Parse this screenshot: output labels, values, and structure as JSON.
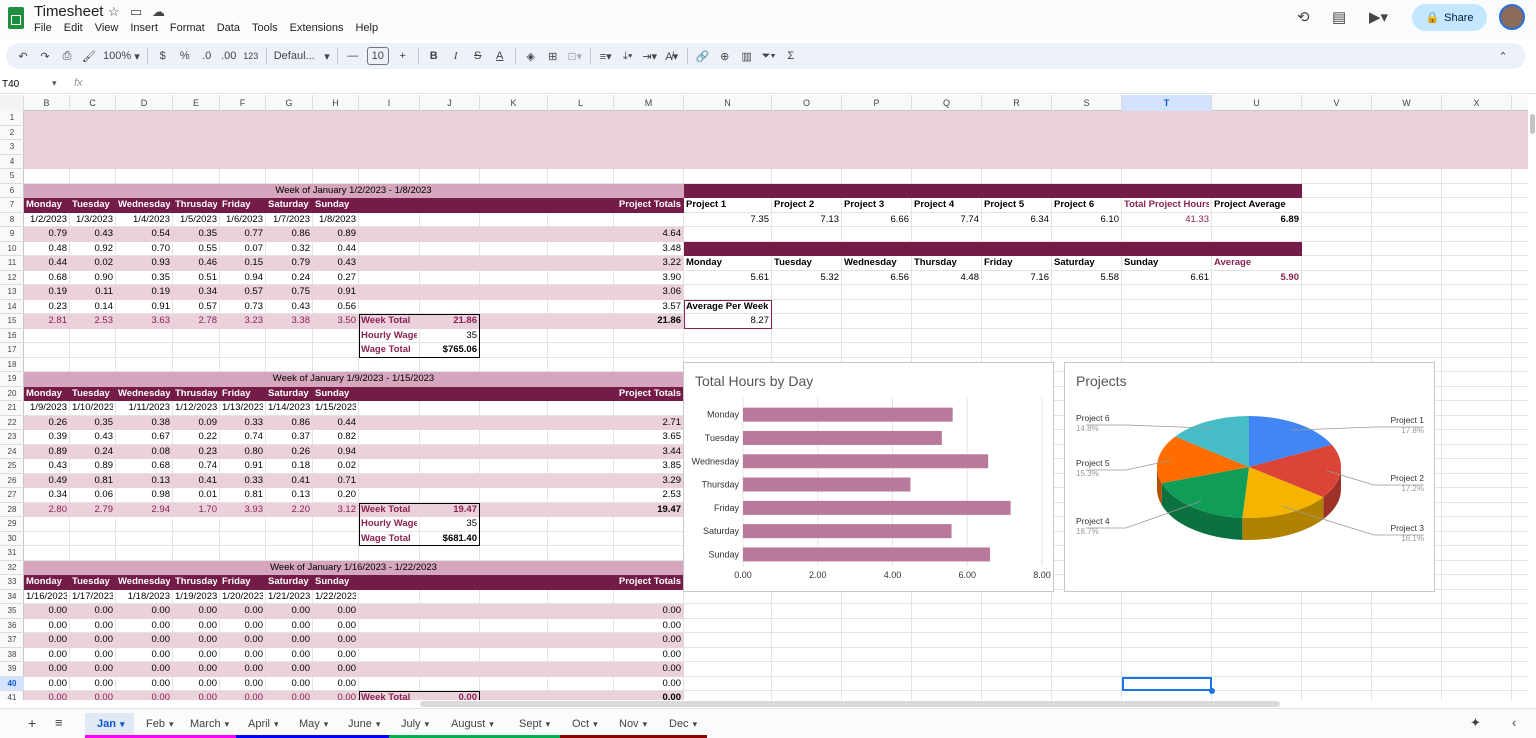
{
  "app": {
    "title": "Timesheet",
    "menus": [
      "File",
      "Edit",
      "View",
      "Insert",
      "Format",
      "Data",
      "Tools",
      "Extensions",
      "Help"
    ],
    "share_label": "Share"
  },
  "toolbar": {
    "zoom": "100%",
    "currency": "$",
    "percent": "%",
    "dec_less": ".0",
    "dec_more": ".00",
    "num_format": "123",
    "font": "Defaul...",
    "font_size": "10",
    "sum": "Σ"
  },
  "formula": {
    "cell_ref": "T40",
    "fx": "fx",
    "value": ""
  },
  "columns": [
    "B",
    "C",
    "D",
    "E",
    "F",
    "G",
    "H",
    "I",
    "J",
    "K",
    "L",
    "M",
    "N",
    "O",
    "P",
    "Q",
    "R",
    "S",
    "T",
    "U",
    "V",
    "W",
    "X"
  ],
  "selected_column": "T",
  "selected_row": "40",
  "rows": [
    "1",
    "2",
    "3",
    "4",
    "5",
    "6",
    "7",
    "8",
    "9",
    "10",
    "11",
    "12",
    "13",
    "14",
    "15",
    "16",
    "17",
    "18",
    "19",
    "20",
    "21",
    "22",
    "23",
    "24",
    "25",
    "26",
    "27",
    "28",
    "29",
    "30",
    "31",
    "32",
    "33",
    "34",
    "35",
    "36",
    "37",
    "38",
    "39",
    "40",
    "41"
  ],
  "day_headers": [
    "Monday",
    "Tuesday",
    "Wednesday",
    "Thrusday",
    "Friday",
    "Saturday",
    "Sunday"
  ],
  "project_totals_label": "Project Totals",
  "week_total_label": "Week Total",
  "hourly_wage_label": "Hourly Wage",
  "wage_total_label": "Wage Total",
  "weeks": [
    {
      "title": "Week of January 1/2/2023 - 1/8/2023",
      "dates": [
        "1/2/2023",
        "1/3/2023",
        "1/4/2023",
        "1/5/2023",
        "1/6/2023",
        "1/7/2023",
        "1/8/2023"
      ],
      "rows": [
        {
          "v": [
            "0.79",
            "0.43",
            "0.54",
            "0.35",
            "0.77",
            "0.86",
            "0.89"
          ],
          "total": "4.64"
        },
        {
          "v": [
            "0.48",
            "0.92",
            "0.70",
            "0.55",
            "0.07",
            "0.32",
            "0.44"
          ],
          "total": "3.48"
        },
        {
          "v": [
            "0.44",
            "0.02",
            "0.93",
            "0.46",
            "0.15",
            "0.79",
            "0.43"
          ],
          "total": "3.22"
        },
        {
          "v": [
            "0.68",
            "0.90",
            "0.35",
            "0.51",
            "0.94",
            "0.24",
            "0.27"
          ],
          "total": "3.90"
        },
        {
          "v": [
            "0.19",
            "0.11",
            "0.19",
            "0.34",
            "0.57",
            "0.75",
            "0.91"
          ],
          "total": "3.06"
        },
        {
          "v": [
            "0.23",
            "0.14",
            "0.91",
            "0.57",
            "0.73",
            "0.43",
            "0.56"
          ],
          "total": "3.57"
        }
      ],
      "day_totals": [
        "2.81",
        "2.53",
        "3.63",
        "2.78",
        "3.23",
        "3.38",
        "3.50"
      ],
      "week_total": "21.86",
      "grand_total": "21.86",
      "hourly_wage": "35",
      "wage_total": "$765.06"
    },
    {
      "title": "Week of January 1/9/2023 - 1/15/2023",
      "dates": [
        "1/9/2023",
        "1/10/2023",
        "1/11/2023",
        "1/12/2023",
        "1/13/2023",
        "1/14/2023",
        "1/15/2023"
      ],
      "rows": [
        {
          "v": [
            "0.26",
            "0.35",
            "0.38",
            "0.09",
            "0.33",
            "0.86",
            "0.44"
          ],
          "total": "2.71"
        },
        {
          "v": [
            "0.39",
            "0.43",
            "0.67",
            "0.22",
            "0.74",
            "0.37",
            "0.82"
          ],
          "total": "3.65"
        },
        {
          "v": [
            "0.89",
            "0.24",
            "0.08",
            "0.23",
            "0.80",
            "0.26",
            "0.94"
          ],
          "total": "3.44"
        },
        {
          "v": [
            "0.43",
            "0.89",
            "0.68",
            "0.74",
            "0.91",
            "0.18",
            "0.02"
          ],
          "total": "3.85"
        },
        {
          "v": [
            "0.49",
            "0.81",
            "0.13",
            "0.41",
            "0.33",
            "0.41",
            "0.71"
          ],
          "total": "3.29"
        },
        {
          "v": [
            "0.34",
            "0.06",
            "0.98",
            "0.01",
            "0.81",
            "0.13",
            "0.20"
          ],
          "total": "2.53"
        }
      ],
      "day_totals": [
        "2.80",
        "2.79",
        "2.94",
        "1.70",
        "3.93",
        "2.20",
        "3.12"
      ],
      "week_total": "19.47",
      "grand_total": "19.47",
      "hourly_wage": "35",
      "wage_total": "$681.40"
    },
    {
      "title": "Week of January 1/16/2023 - 1/22/2023",
      "dates": [
        "1/16/2023",
        "1/17/2023",
        "1/18/2023",
        "1/19/2023",
        "1/20/2023",
        "1/21/2023",
        "1/22/2023"
      ],
      "rows": [
        {
          "v": [
            "0.00",
            "0.00",
            "0.00",
            "0.00",
            "0.00",
            "0.00",
            "0.00"
          ],
          "total": "0.00"
        },
        {
          "v": [
            "0.00",
            "0.00",
            "0.00",
            "0.00",
            "0.00",
            "0.00",
            "0.00"
          ],
          "total": "0.00"
        },
        {
          "v": [
            "0.00",
            "0.00",
            "0.00",
            "0.00",
            "0.00",
            "0.00",
            "0.00"
          ],
          "total": "0.00"
        },
        {
          "v": [
            "0.00",
            "0.00",
            "0.00",
            "0.00",
            "0.00",
            "0.00",
            "0.00"
          ],
          "total": "0.00"
        },
        {
          "v": [
            "0.00",
            "0.00",
            "0.00",
            "0.00",
            "0.00",
            "0.00",
            "0.00"
          ],
          "total": "0.00"
        },
        {
          "v": [
            "0.00",
            "0.00",
            "0.00",
            "0.00",
            "0.00",
            "0.00",
            "0.00"
          ],
          "total": "0.00"
        }
      ],
      "day_totals": [
        "0.00",
        "0.00",
        "0.00",
        "0.00",
        "0.00",
        "0.00",
        "0.00"
      ],
      "week_total": "0.00",
      "grand_total": "0.00"
    }
  ],
  "summary": {
    "project_headers": [
      "Project 1",
      "Project 2",
      "Project 3",
      "Project 4",
      "Project 5",
      "Project 6",
      "Total Project Hours",
      "Project Average"
    ],
    "project_values": [
      "7.35",
      "7.13",
      "6.66",
      "7.74",
      "6.34",
      "6.10",
      "41.33",
      "6.89"
    ],
    "day_headers": [
      "Monday",
      "Tuesday",
      "Wednesday",
      "Thursday",
      "Friday",
      "Saturday",
      "Sunday",
      "Average"
    ],
    "day_values": [
      "5.61",
      "5.32",
      "6.56",
      "4.48",
      "7.16",
      "5.58",
      "6.61",
      "5.90"
    ],
    "avg_week_label": "Average Per Week",
    "avg_week_value": "8.27"
  },
  "chart_data": [
    {
      "type": "bar",
      "orientation": "horizontal",
      "title": "Total Hours by Day",
      "categories": [
        "Monday",
        "Tuesday",
        "Wednesday",
        "Thursday",
        "Friday",
        "Saturday",
        "Sunday"
      ],
      "values": [
        5.61,
        5.32,
        6.56,
        4.48,
        7.16,
        5.58,
        6.61
      ],
      "xlim": [
        0,
        8
      ],
      "ticks": [
        "0.00",
        "2.00",
        "4.00",
        "6.00",
        "8.00"
      ],
      "color": "#b9799a"
    },
    {
      "type": "pie",
      "title": "Projects",
      "categories": [
        "Project 1",
        "Project 2",
        "Project 3",
        "Project 4",
        "Project 5",
        "Project 6"
      ],
      "values": [
        17.8,
        17.2,
        16.1,
        18.7,
        15.3,
        14.8
      ],
      "labels": [
        "17.8%",
        "17.2%",
        "16.1%",
        "18.7%",
        "15.3%",
        "14.8%"
      ],
      "colors": [
        "#4285f4",
        "#db4437",
        "#f4b400",
        "#0f9d58",
        "#ff6d01",
        "#46bdc6"
      ]
    }
  ],
  "sheets": [
    "Jan",
    "Feb",
    "March",
    "April",
    "May",
    "June",
    "July",
    "August",
    "Sept",
    "Oct",
    "Nov",
    "Dec"
  ],
  "active_sheet": "Jan",
  "colors": {
    "header_dark": "#741b47",
    "header_light": "#d5a6bd",
    "band": "#ead1dc",
    "accent": "#8b2252"
  }
}
